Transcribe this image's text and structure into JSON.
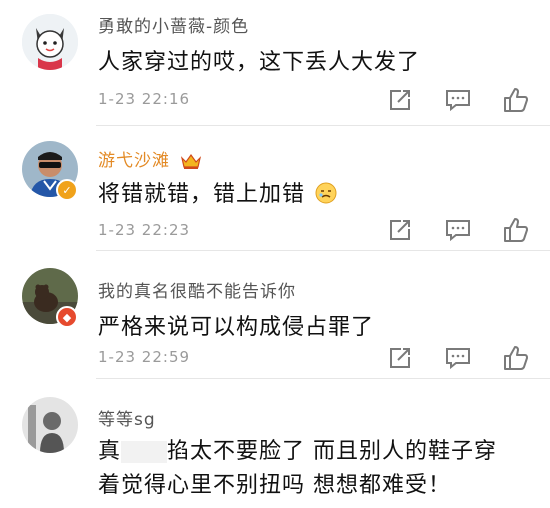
{
  "comments": [
    {
      "name": "勇敢的小蔷薇-颜色",
      "text": "人家穿过的哎，这下丢人大发了",
      "time": "1-23 22:16",
      "vip": false
    },
    {
      "name": "游弋沙滩",
      "text": "将错就错，错上加错",
      "time": "1-23 22:23",
      "vip": true
    },
    {
      "name": "我的真名很酷不能告诉你",
      "text": "严格来说可以构成侵占罪了",
      "time": "1-23 22:59",
      "vip": false
    },
    {
      "name": "等等sg",
      "text_part1": "真",
      "text_part2": "掐太不要脸了 而且别人的鞋子穿",
      "text_line2": "着觉得心里不别扭吗 想想都难受！",
      "vip": false
    }
  ],
  "colors": {
    "vip_name": "#e38a25",
    "name": "#555555",
    "time": "#9a9a9a",
    "icon": "#7a7a7a",
    "verified_badge": "#f0a21b",
    "club_badge": "#e64a2e"
  },
  "icons": [
    "share-icon",
    "comment-icon",
    "like-icon",
    "crown-icon",
    "verified-icon"
  ]
}
